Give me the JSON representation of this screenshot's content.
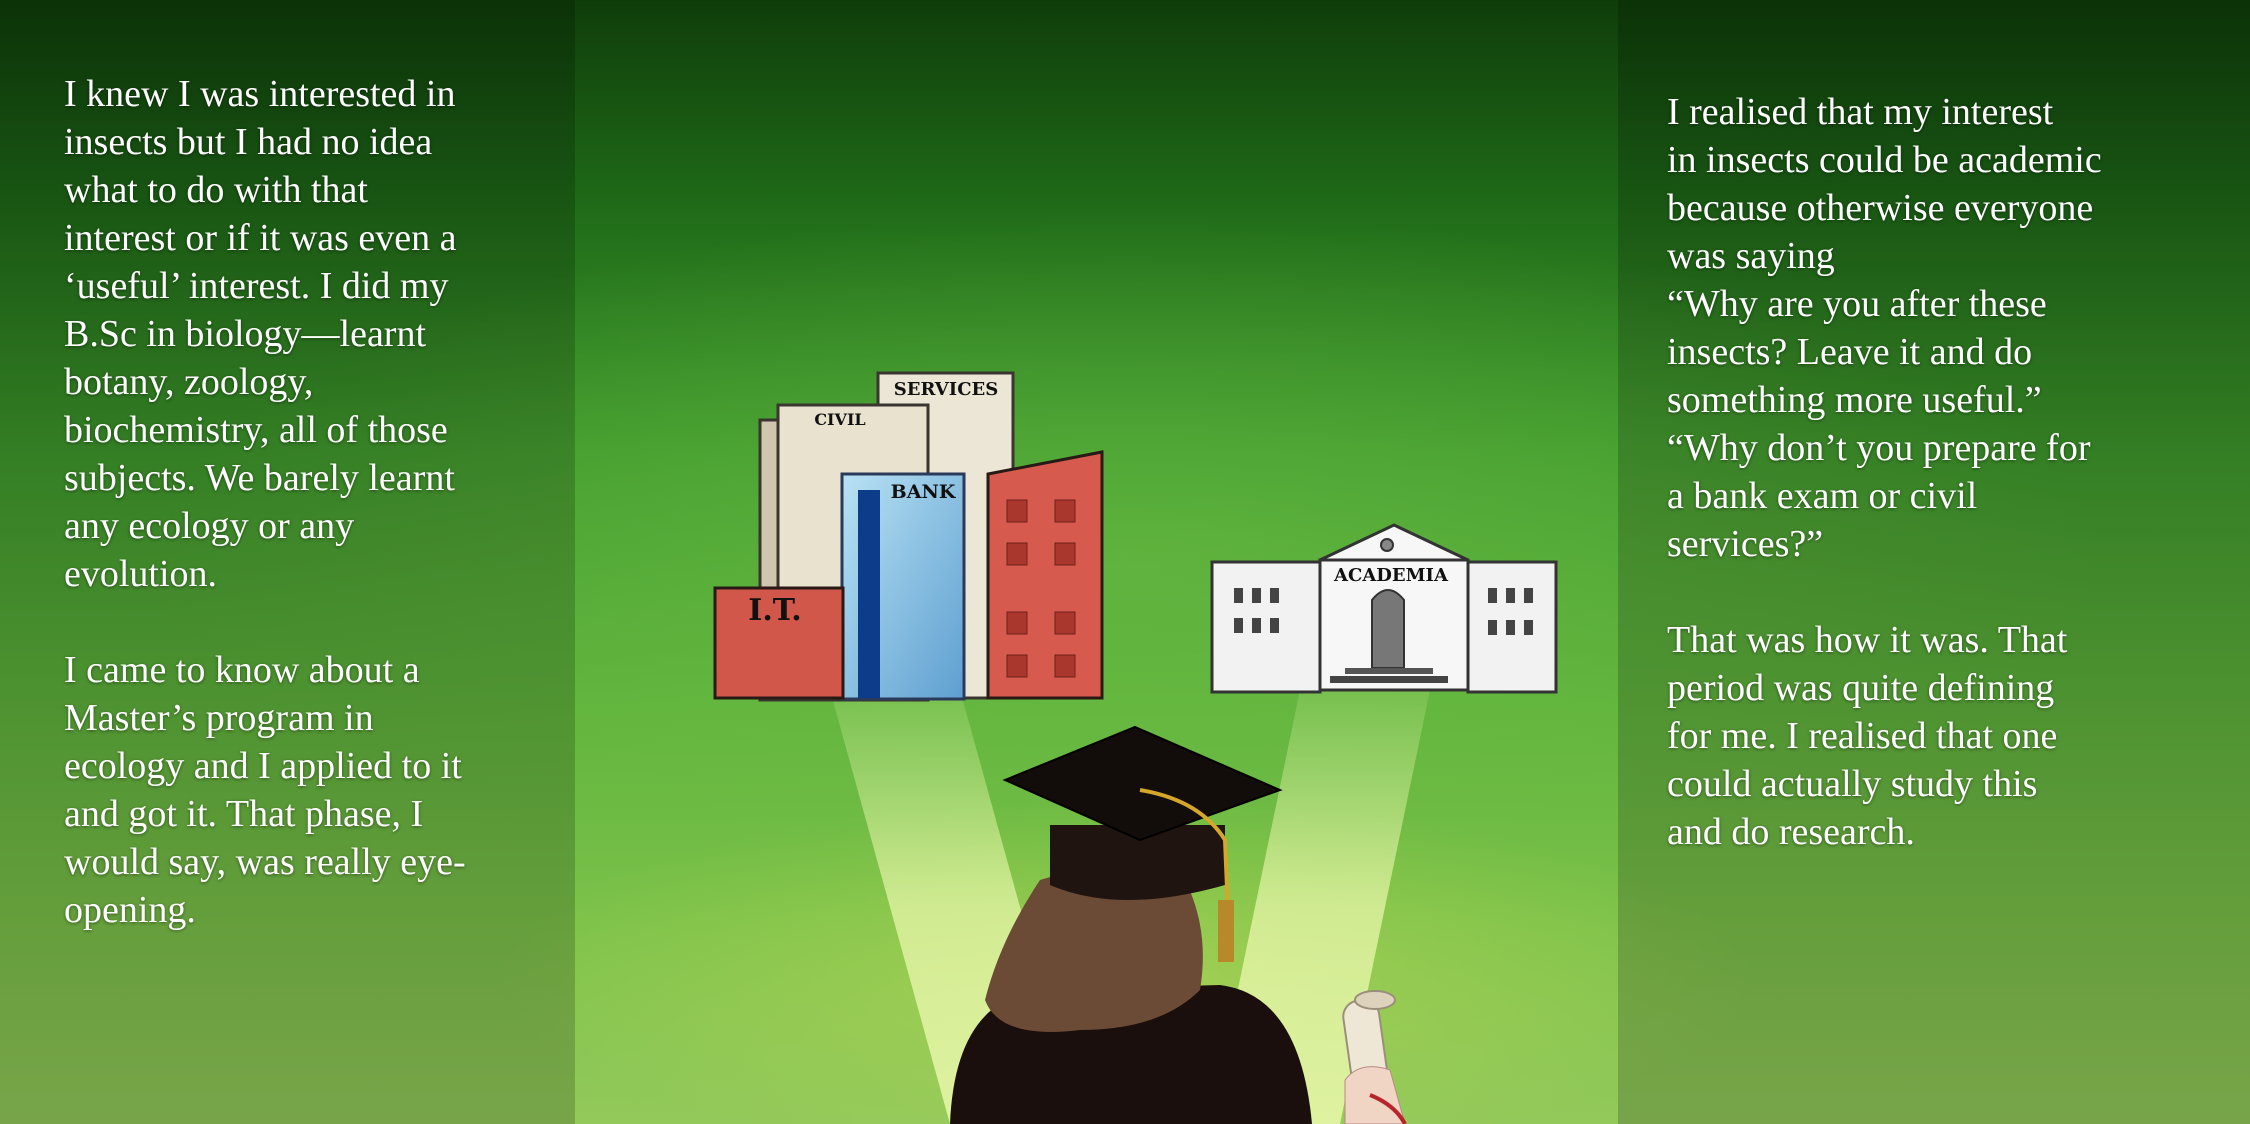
{
  "left_column": {
    "paragraphs": [
      "I knew I was interested in\ninsects but I had no idea\nwhat to do with that\ninterest or if it was even a\n‘useful’ interest. I did my\nB.Sc in biology—learnt\nbotany, zoology,\nbiochemistry, all of those\nsubjects. We barely learnt\nany ecology or any\nevolution.",
      "I came to know about a\nMaster’s program in\necology and I applied to it\nand got it. That phase, I\nwould say, was really eye-\nopening."
    ]
  },
  "right_column": {
    "paragraphs": [
      " I realised that my interest\nin insects could be academic\nbecause otherwise everyone\nwas saying\n“Why are you after these\ninsects? Leave it and do\nsomething more useful.”\n“Why don’t you prepare for\na bank exam or civil\nservices?”",
      "That was how it was. That\nperiod was quite defining\nfor me. I realised that one\ncould actually study this\nand do research."
    ]
  },
  "illustration": {
    "building_labels": {
      "services": "SERVICES",
      "civil": "CIVIL",
      "bank": "BANK",
      "it": "I.T.",
      "academia": "ACADEMIA"
    },
    "colors": {
      "it_building": "#d0574a",
      "bank_building": "#8fcbe6",
      "tower_building": "#d65a4e",
      "cream_building": "#e9e2cf",
      "academia_building": "#f2f2f2",
      "gown": "#1a0f0c",
      "hair": "#6b4a36",
      "tassel": "#d4a62a",
      "spotlight": "#e6f6a8"
    },
    "icons": [
      "graduate-figure",
      "diploma-scroll",
      "spotlight-left",
      "spotlight-right"
    ]
  }
}
